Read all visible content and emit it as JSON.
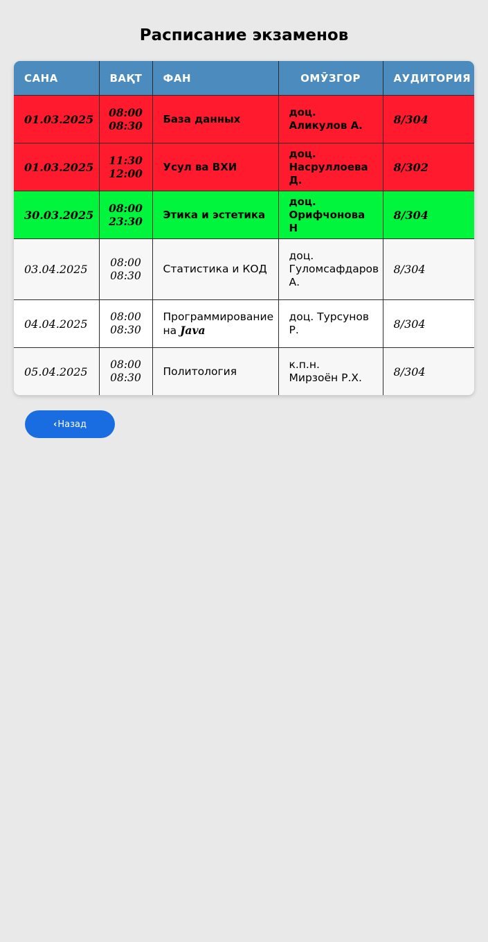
{
  "page": {
    "title": "Расписание экзаменов"
  },
  "table": {
    "headers": {
      "date": "САНА",
      "time": "ВАҚТ",
      "subject": "ФАН",
      "teacher": "ОМӮЗГОР",
      "room": "АУДИТОРИЯ"
    },
    "rows": [
      {
        "date": "01.03.2025",
        "time_start": "08:00",
        "time_end": "08:30",
        "subject": "База данных",
        "subject_suffix": "",
        "teacher": "доц. Аликулов А.",
        "room": "8/304",
        "status": "red"
      },
      {
        "date": "01.03.2025",
        "time_start": "11:30",
        "time_end": "12:00",
        "subject": "Усул ва ВХИ",
        "subject_suffix": "",
        "teacher": "доц. Насруллоева Д.",
        "room": "8/302",
        "status": "red"
      },
      {
        "date": "30.03.2025",
        "time_start": "08:00",
        "time_end": "23:30",
        "subject": "Этика и эстетика",
        "subject_suffix": "",
        "teacher": "доц. Орифчонова Н",
        "room": "8/304",
        "status": "green"
      },
      {
        "date": "03.04.2025",
        "time_start": "08:00",
        "time_end": "08:30",
        "subject": "Статистика и КОД",
        "subject_suffix": "",
        "teacher": "доц. Гуломсафдаров А.",
        "room": "8/304",
        "status": "none"
      },
      {
        "date": "04.04.2025",
        "time_start": "08:00",
        "time_end": "08:30",
        "subject": "Программирование на ",
        "subject_suffix": "Java",
        "teacher": "доц. Турсунов Р.",
        "room": "8/304",
        "status": "none"
      },
      {
        "date": "05.04.2025",
        "time_start": "08:00",
        "time_end": "08:30",
        "subject": "Политология",
        "subject_suffix": "",
        "teacher": "к.п.н. Мирзоён Р.Х.",
        "room": "8/304",
        "status": "none"
      }
    ]
  },
  "back_button": {
    "icon": "chevron-left-icon",
    "label": "Назад"
  },
  "colors": {
    "header": "#4b8bbe",
    "status_red": "#ff1a2e",
    "status_green": "#00f53c",
    "button": "#1a6de0",
    "background": "#e9e9e9"
  }
}
